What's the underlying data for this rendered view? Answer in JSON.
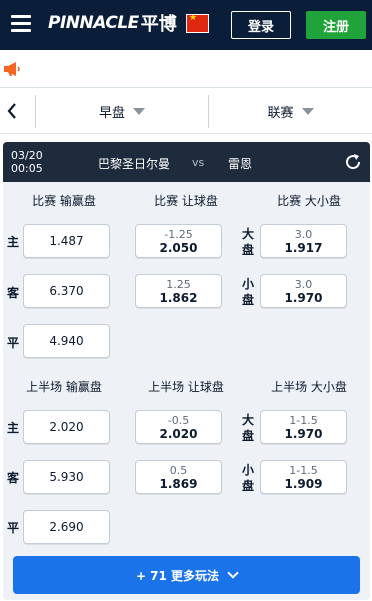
{
  "header": {
    "brand_en": "PINNACLE",
    "brand_cn": "平博",
    "flag": "china-flag-icon",
    "login_label": "登录",
    "register_label": "注册",
    "bg_color": "#0a1e3a",
    "register_color": "#1fa33a"
  },
  "filters": {
    "market_label": "早盘",
    "league_label": "联赛"
  },
  "match": {
    "date": "03/20",
    "time": "00:05",
    "home": "巴黎圣日尔曼",
    "vs": "vs",
    "away": "雷恩"
  },
  "full_time": {
    "moneyline_title": "比赛 输赢盘",
    "handicap_title": "比赛 让球盘",
    "total_title": "比赛 大小盘",
    "labels": {
      "home": "主",
      "away": "客",
      "draw": "平",
      "over": "大盘",
      "under": "小盘"
    },
    "moneyline": {
      "home": "1.487",
      "away": "6.370",
      "draw": "4.940"
    },
    "handicap": [
      {
        "line": "-1.25",
        "price": "2.050"
      },
      {
        "line": "1.25",
        "price": "1.862"
      }
    ],
    "total": [
      {
        "line": "3.0",
        "price": "1.917"
      },
      {
        "line": "3.0",
        "price": "1.970"
      }
    ]
  },
  "first_half": {
    "moneyline_title": "上半场 输赢盘",
    "handicap_title": "上半场 让球盘",
    "total_title": "上半场 大小盘",
    "labels": {
      "home": "主",
      "away": "客",
      "draw": "平",
      "over": "大盘",
      "under": "小盘"
    },
    "moneyline": {
      "home": "2.020",
      "away": "5.930",
      "draw": "2.690"
    },
    "handicap": [
      {
        "line": "-0.5",
        "price": "2.020"
      },
      {
        "line": "0.5",
        "price": "1.869"
      }
    ],
    "total": [
      {
        "line": "1-1.5",
        "price": "1.970"
      },
      {
        "line": "1-1.5",
        "price": "1.909"
      }
    ]
  },
  "more": {
    "label": "+ 71 更多玩法"
  }
}
